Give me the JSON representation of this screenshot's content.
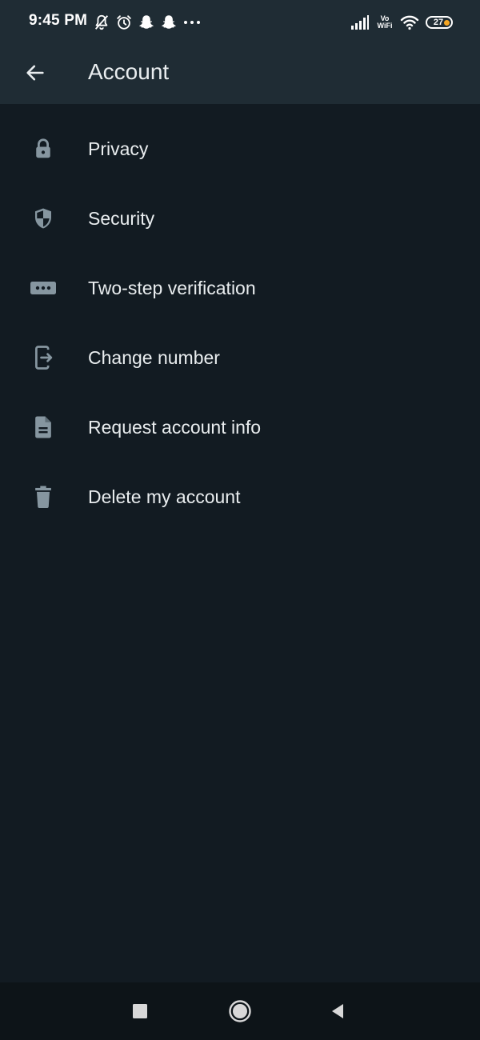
{
  "status_bar": {
    "time": "9:45 PM",
    "icons_left": [
      "bell-off-icon",
      "alarm-icon",
      "snapchat-icon",
      "snapchat-icon",
      "more-dots-icon"
    ],
    "vowifi_top": "Vo",
    "vowifi_bottom": "WiFi",
    "battery_level": "27"
  },
  "app_bar": {
    "title": "Account",
    "back_icon": "arrow-left-icon"
  },
  "menu": {
    "items": [
      {
        "label": "Privacy",
        "icon": "lock-icon"
      },
      {
        "label": "Security",
        "icon": "shield-icon"
      },
      {
        "label": "Two-step verification",
        "icon": "password-dots-icon"
      },
      {
        "label": "Change number",
        "icon": "phone-transfer-icon"
      },
      {
        "label": "Request account info",
        "icon": "document-icon"
      },
      {
        "label": "Delete my account",
        "icon": "trash-icon"
      }
    ]
  },
  "nav_bar": {
    "buttons": [
      "recents-square-icon",
      "home-circle-icon",
      "back-triangle-icon"
    ]
  },
  "colors": {
    "background": "#121b22",
    "header": "#1f2c34",
    "icon": "#8696a0",
    "text": "#e9edef",
    "nav_bar": "#0d1418",
    "battery_dot": "#f5a623"
  }
}
